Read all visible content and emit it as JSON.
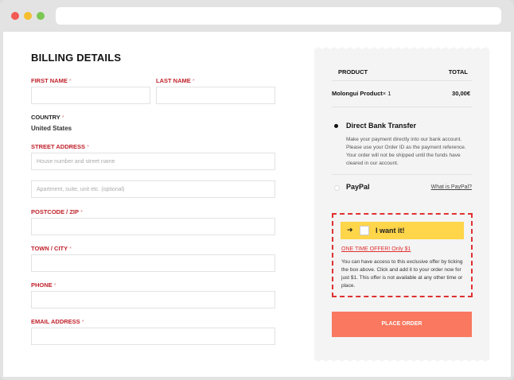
{
  "billing": {
    "title": "BILLING DETAILS",
    "first_name_label": "FIRST NAME",
    "last_name_label": "LAST NAME",
    "country_label": "COUNTRY",
    "country_value": "United States",
    "street_label": "STREET ADDRESS",
    "street_placeholder": "House number and street name",
    "street2_placeholder": "Apartment, suite, unit etc. (optional)",
    "postcode_label": "POSTCODE / ZIP",
    "town_label": "TOWN / CITY",
    "phone_label": "PHONE",
    "email_label": "EMAIL ADDRESS",
    "required_mark": "*"
  },
  "order": {
    "product_header": "PRODUCT",
    "total_header": "TOTAL",
    "product_name": "Molongui Product",
    "product_qty": "× 1",
    "product_total": "30,00€",
    "bank_transfer_label": "Direct Bank Transfer",
    "bank_transfer_desc": "Make your payment directly into our bank account. Please use your Order ID as the payment reference. Your order will not be shipped until the funds have cleared in our account.",
    "paypal_label": "PayPal",
    "paypal_link": "What is PayPal?",
    "place_order_label": "PLACE ORDER"
  },
  "offer": {
    "arrow": "➜",
    "want_label": "I want it!",
    "headline": "ONE TIME OFFER! Only $1",
    "text": "You can have access to this exclusive offer by ticking the box above. Click and add it to your order now for just $1. This offer is not available at any other time or place."
  },
  "colors": {
    "label_red": "#c0222b",
    "offer_border": "#e03131",
    "offer_bar": "#ffd54a",
    "place_order": "#f9785f"
  }
}
